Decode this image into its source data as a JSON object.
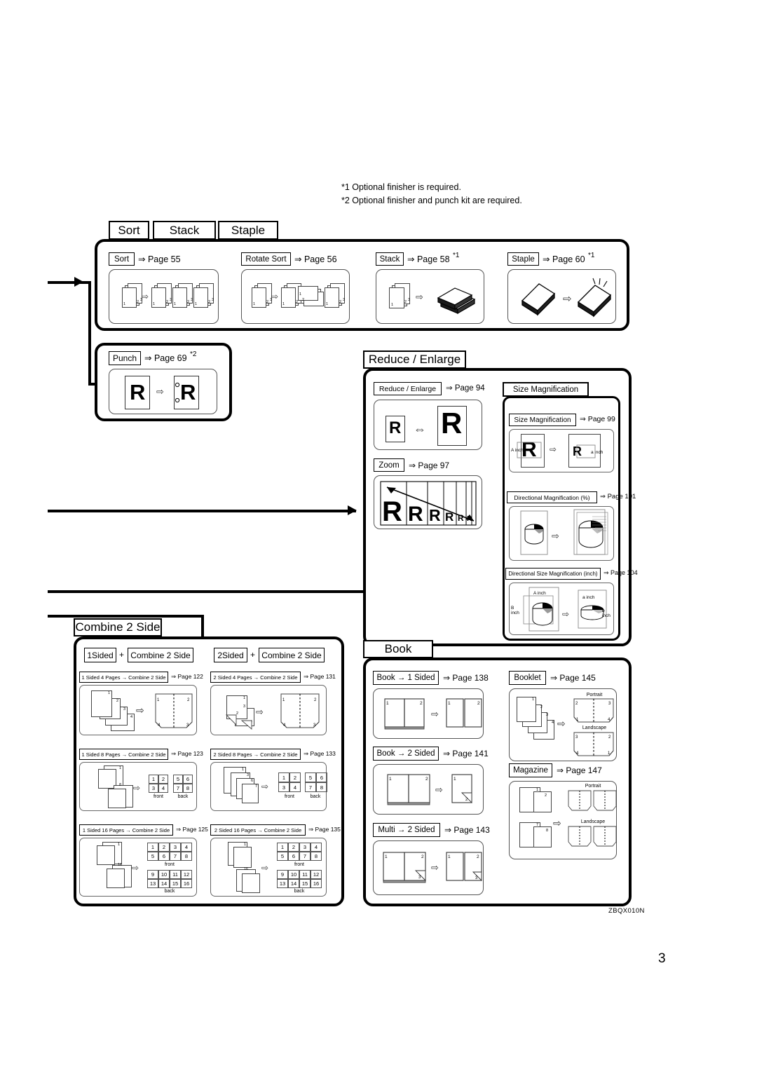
{
  "document": {
    "page_number": "3",
    "figure_code": "ZBQX010N",
    "footnotes": [
      "*1 Optional finisher is required.",
      "*2 Optional finisher and punch kit are required."
    ]
  },
  "sections": {
    "sort_stack_staple": {
      "headers": [
        "Sort",
        "Stack",
        "Staple"
      ],
      "items": [
        {
          "label": "Sort",
          "ref": "⇒ Page 55",
          "footnote": ""
        },
        {
          "label": "Rotate Sort",
          "ref": "⇒ Page 56",
          "footnote": ""
        },
        {
          "label": "Stack",
          "ref": "⇒ Page 58",
          "footnote": "*1"
        },
        {
          "label": "Staple",
          "ref": "⇒ Page 60",
          "footnote": "*1"
        }
      ]
    },
    "punch": {
      "items": [
        {
          "label": "Punch",
          "ref": "⇒ Page 69",
          "footnote": "*2"
        }
      ]
    },
    "reduce_enlarge": {
      "header": "Reduce / Enlarge",
      "items": [
        {
          "label": "Reduce / Enlarge",
          "ref": "⇒ Page 94",
          "footnote": ""
        },
        {
          "label": "Zoom",
          "ref": "⇒ Page 97",
          "footnote": ""
        }
      ]
    },
    "size_magnification": {
      "header": "Size Magnification",
      "items": [
        {
          "label": "Size Magnification",
          "ref": "⇒ Page 99",
          "footnote": ""
        },
        {
          "label": "Directional Magnification (%)",
          "ref": "⇒ Page 101",
          "footnote": ""
        },
        {
          "label": "Directional  Size Magnification (inch)",
          "ref": "⇒ Page 104",
          "footnote": ""
        }
      ],
      "dimension_labels": {
        "source_width": "A inch",
        "source_height": "B\ninch",
        "target_width": "a inch",
        "target_height": "b\ninch"
      }
    },
    "combine_2_side": {
      "header": "Combine 2 Side",
      "columns": [
        {
          "mode_left": "1Sided",
          "plus": "+",
          "mode_right": "Combine 2 Side",
          "items": [
            {
              "label": "1 Sided 4 Pages → Combine 2 Side",
              "ref": "⇒  Page 122"
            },
            {
              "label": "1 Sided 8 Pages → Combine 2 Side",
              "ref": "⇒  Page 123"
            },
            {
              "label": "1 Sided 16 Pages → Combine 2 Side",
              "ref": "⇒  Page 125"
            }
          ]
        },
        {
          "mode_left": "2Sided",
          "plus": "+",
          "mode_right": "Combine 2 Side",
          "items": [
            {
              "label": "2 Sided 4 Pages → Combine 2 Side",
              "ref": "⇒ Page 131"
            },
            {
              "label": "2 Sided 8 Pages → Combine 2 Side",
              "ref": "⇒  Page 133"
            },
            {
              "label": "2 Sided 16 Pages → Combine 2 Side",
              "ref": "⇒ Page 135"
            }
          ]
        }
      ],
      "page_grids": {
        "eight_front": [
          [
            "1",
            "2"
          ],
          [
            "3",
            "4"
          ]
        ],
        "eight_back": [
          [
            "5",
            "6"
          ],
          [
            "7",
            "8"
          ]
        ],
        "sixteen_front": [
          [
            "1",
            "2",
            "3",
            "4"
          ],
          [
            "5",
            "6",
            "7",
            "8"
          ]
        ],
        "sixteen_back": [
          [
            "9",
            "10",
            "11",
            "12"
          ],
          [
            "13",
            "14",
            "15",
            "16"
          ]
        ],
        "front_label": "front",
        "back_label": "back"
      }
    },
    "book": {
      "header": "Book",
      "items": [
        {
          "label": "Book → 1 Sided",
          "ref": "⇒ Page 138"
        },
        {
          "label": "Book → 2 Sided",
          "ref": "⇒ Page 141"
        },
        {
          "label": "Multi → 2 Sided",
          "ref": "⇒ Page 143"
        }
      ]
    },
    "booklet_magazine": {
      "items": [
        {
          "label": "Booklet",
          "ref": "⇒ Page 145"
        },
        {
          "label": "Magazine",
          "ref": "⇒ Page 147"
        }
      ],
      "orientation_labels": {
        "portrait": "Portrait",
        "landscape": "Landscape"
      }
    }
  },
  "glyphs": {
    "letter_r": "R",
    "open_arrow": "⇨",
    "double_arrow": "⇔"
  },
  "colors": {
    "ink": "#000000",
    "rule": "#555555"
  }
}
